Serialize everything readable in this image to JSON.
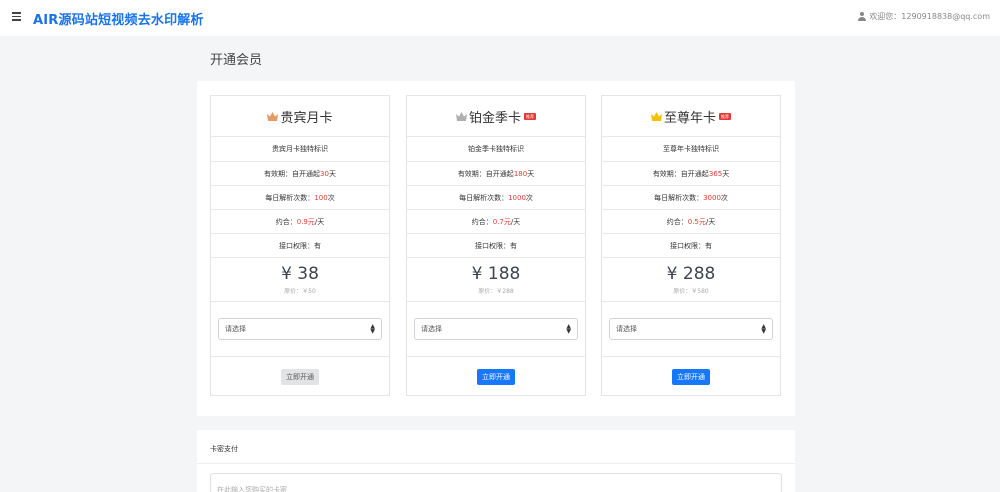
{
  "header": {
    "title": "AIR源码站短视频去水印解析",
    "user": "欢迎您：1290918838@qq.com"
  },
  "page_title": "开通会员",
  "plans": [
    {
      "name": "贵宾月卡",
      "badge": "",
      "crown_color": "#e59a63",
      "desc": "贵宾月卡独特标识",
      "validity_label": "有效期：自开通起",
      "validity_value": "30",
      "validity_unit": "天",
      "daily_label": "每日解析次数：",
      "daily_value": "100",
      "daily_unit": "次",
      "avg_label": "约合：",
      "avg_value": "0.9元",
      "avg_unit": "/天",
      "api": "接口权限：有",
      "price": "¥ 38",
      "original": "原价：￥50",
      "select_placeholder": "请选择",
      "button": "立即开通",
      "button_style": "gray"
    },
    {
      "name": "铂金季卡",
      "badge": "推荐",
      "crown_color": "#b0b0b0",
      "desc": "铂金季卡独特标识",
      "validity_label": "有效期：自开通起",
      "validity_value": "180",
      "validity_unit": "天",
      "daily_label": "每日解析次数：",
      "daily_value": "1000",
      "daily_unit": "次",
      "avg_label": "约合：",
      "avg_value": "0.7元",
      "avg_unit": "/天",
      "api": "接口权限：有",
      "price": "¥ 188",
      "original": "原价：￥288",
      "select_placeholder": "请选择",
      "button": "立即开通",
      "button_style": "blue"
    },
    {
      "name": "至尊年卡",
      "badge": "推荐",
      "crown_color": "#f5c000",
      "desc": "至尊年卡独特标识",
      "validity_label": "有效期：自开通起",
      "validity_value": "365",
      "validity_unit": "天",
      "daily_label": "每日解析次数：",
      "daily_value": "3000",
      "daily_unit": " 次",
      "avg_label": "约合：",
      "avg_value": "0.5元",
      "avg_unit": "/天",
      "api": "接口权限：有",
      "price": "¥ 288",
      "original": "原价：￥580",
      "select_placeholder": "请选择",
      "button": "立即开通",
      "button_style": "blue"
    }
  ],
  "card_pay": {
    "title": "卡密支付",
    "placeholder": "在此输入您购买的卡密"
  }
}
